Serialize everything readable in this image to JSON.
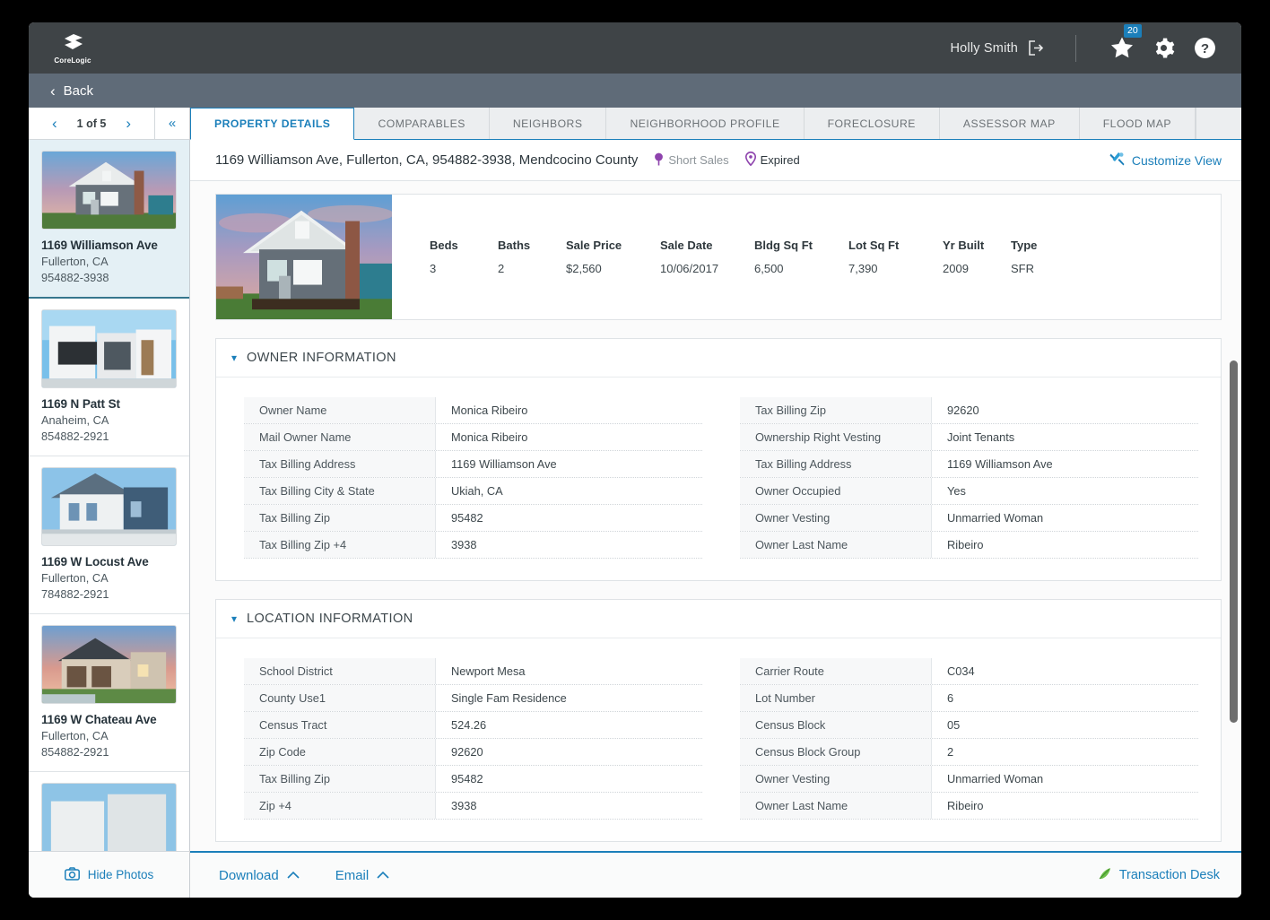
{
  "topbar": {
    "logo_text": "CoreLogic",
    "user_name": "Holly Smith",
    "favorites_badge": "20",
    "icons": {
      "logout": "logout-icon",
      "star": "star-icon",
      "gear": "gear-icon",
      "help": "help-icon"
    }
  },
  "backbar": {
    "label": "Back"
  },
  "sidebar": {
    "pager": {
      "count": "1 of 5",
      "prev": "‹",
      "next": "›",
      "collapse": "«"
    },
    "hide_photos_label": "Hide Photos",
    "properties": [
      {
        "title": "1169 Williamson Ave",
        "city": "Fullerton, CA",
        "zip": "954882-3938",
        "active": true
      },
      {
        "title": "1169 N Patt St",
        "city": "Anaheim, CA",
        "zip": "854882-2921",
        "active": false
      },
      {
        "title": "1169 W Locust Ave",
        "city": "Fullerton, CA",
        "zip": "784882-2921",
        "active": false
      },
      {
        "title": "1169 W Chateau Ave",
        "city": "Fullerton, CA",
        "zip": "854882-2921",
        "active": false
      }
    ]
  },
  "tabs": [
    {
      "label": "PROPERTY DETAILS",
      "active": true
    },
    {
      "label": "COMPARABLES",
      "active": false
    },
    {
      "label": "NEIGHBORS",
      "active": false
    },
    {
      "label": "NEIGHBORHOOD PROFILE",
      "active": false
    },
    {
      "label": "FORECLOSURE",
      "active": false
    },
    {
      "label": "ASSESSOR MAP",
      "active": false
    },
    {
      "label": "FLOOD MAP",
      "active": false
    }
  ],
  "address_row": {
    "address": "1169 Williamson Ave, Fullerton, CA, 954882-3938, Mendcocino County",
    "tag_short_sales": "Short Sales",
    "tag_expired": "Expired",
    "customize_view": "Customize View"
  },
  "summary": {
    "stats": [
      {
        "label": "Beds",
        "value": "3"
      },
      {
        "label": "Baths",
        "value": "2"
      },
      {
        "label": "Sale Price",
        "value": "$2,560"
      },
      {
        "label": "Sale Date",
        "value": "10/06/2017"
      },
      {
        "label": "Bldg Sq Ft",
        "value": "6,500"
      },
      {
        "label": "Lot Sq Ft",
        "value": "7,390"
      },
      {
        "label": "Yr Built",
        "value": "2009"
      },
      {
        "label": "Type",
        "value": "SFR"
      }
    ]
  },
  "sections": [
    {
      "title": "OWNER INFORMATION",
      "left": [
        {
          "key": "Owner Name",
          "value": "Monica Ribeiro"
        },
        {
          "key": "Mail Owner Name",
          "value": "Monica Ribeiro"
        },
        {
          "key": "Tax Billing Address",
          "value": "1169 Williamson Ave"
        },
        {
          "key": "Tax Billing City & State",
          "value": "Ukiah, CA"
        },
        {
          "key": "Tax Billing Zip",
          "value": "95482"
        },
        {
          "key": "Tax Billing Zip +4",
          "value": "3938"
        }
      ],
      "right": [
        {
          "key": "Tax Billing Zip",
          "value": "92620"
        },
        {
          "key": "Ownership Right Vesting",
          "value": "Joint Tenants"
        },
        {
          "key": "Tax Billing Address",
          "value": "1169 Williamson Ave"
        },
        {
          "key": "Owner Occupied",
          "value": "Yes"
        },
        {
          "key": "Owner Vesting",
          "value": "Unmarried Woman"
        },
        {
          "key": "Owner Last Name",
          "value": "Ribeiro"
        }
      ]
    },
    {
      "title": "LOCATION INFORMATION",
      "left": [
        {
          "key": "School District",
          "value": "Newport Mesa"
        },
        {
          "key": "County Use1",
          "value": "Single Fam Residence"
        },
        {
          "key": "Census Tract",
          "value": "524.26"
        },
        {
          "key": "Zip Code",
          "value": "92620"
        },
        {
          "key": "Tax Billing Zip",
          "value": "95482"
        },
        {
          "key": "Zip +4",
          "value": "3938"
        }
      ],
      "right": [
        {
          "key": "Carrier Route",
          "value": "C034"
        },
        {
          "key": "Lot Number",
          "value": "6"
        },
        {
          "key": "Census Block",
          "value": "05"
        },
        {
          "key": "Census Block Group",
          "value": "2"
        },
        {
          "key": "Owner Vesting",
          "value": "Unmarried Woman"
        },
        {
          "key": "Owner Last Name",
          "value": "Ribeiro"
        }
      ]
    }
  ],
  "bottombar": {
    "download_label": "Download",
    "email_label": "Email",
    "transaction_desk_label": "Transaction Desk",
    "caret": "⌃"
  },
  "colors": {
    "accent": "#1b7fba",
    "topbar_bg": "#3f4447",
    "backbar_bg": "#5f6b78",
    "tag_purple": "#8e43ad",
    "active_row_bg": "#e4f0f5",
    "green": "#4caf50"
  }
}
